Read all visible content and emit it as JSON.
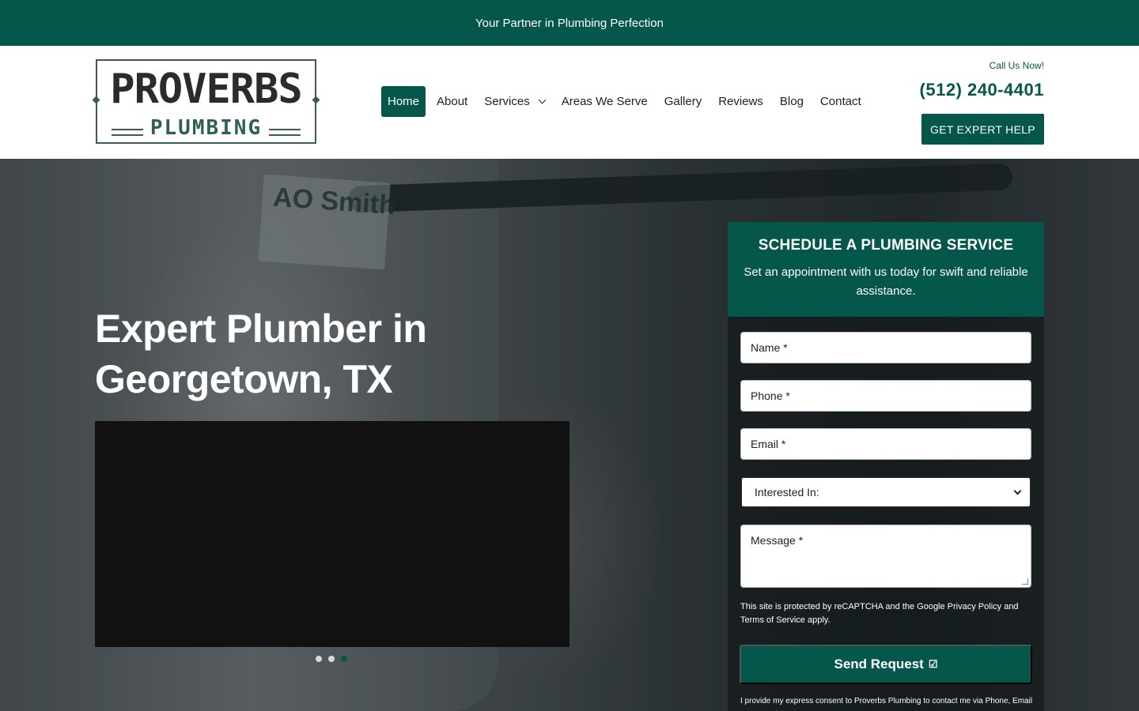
{
  "topbar": {
    "tagline": "Your Partner in Plumbing Perfection"
  },
  "header": {
    "logo": {
      "line1": "PROVERBS",
      "line2": "PLUMBING"
    },
    "nav": [
      {
        "label": "Home",
        "active": true
      },
      {
        "label": "About"
      },
      {
        "label": "Services",
        "dropdown": true
      },
      {
        "label": "Areas We Serve"
      },
      {
        "label": "Gallery"
      },
      {
        "label": "Reviews"
      },
      {
        "label": "Blog"
      },
      {
        "label": "Contact"
      }
    ],
    "call_label": "Call Us Now!",
    "phone": "(512) 240-4401",
    "cta_label": "GET EXPERT HELP"
  },
  "hero": {
    "title": "Expert Plumber in Georgetown, TX",
    "background_brand_text": "AO Smith",
    "slider": {
      "total": 3,
      "active_index": 2
    }
  },
  "form": {
    "heading": "SCHEDULE A PLUMBING SERVICE",
    "subheading": "Set an appointment with us today for swift and reliable assistance.",
    "fields": {
      "name": "Name *",
      "phone": "Phone *",
      "email": "Email *",
      "interested": "Interested In:",
      "message": "Message *"
    },
    "recaptcha_note": "This site is protected by reCAPTCHA and the Google Privacy Policy and Terms of Service apply.",
    "submit_label": "Send Request",
    "consent": "I provide my express consent to Proverbs Plumbing to contact me via Phone, Email"
  },
  "colors": {
    "brand": "#04574a",
    "text": "#222222"
  }
}
